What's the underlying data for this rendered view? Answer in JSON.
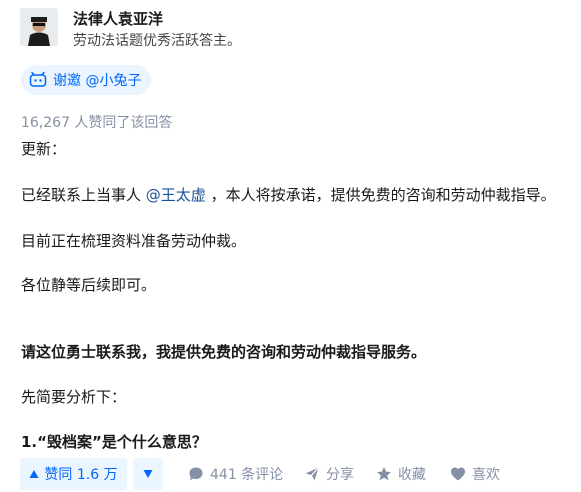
{
  "author": {
    "name": "法律人袁亚洋",
    "bio": "劳动法话题优秀活跃答主。"
  },
  "invite": {
    "label": "谢邀 @小兔子"
  },
  "vote_summary": "16,267 人赞同了该回答",
  "content": {
    "p1": "更新：",
    "p2_before": "已经联系上当事人 ",
    "p2_mention": "@王太虚",
    "p2_after": " ，本人将按承诺，提供免费的咨询和劳动仲裁指导。",
    "p3": "目前正在梳理资料准备劳动仲裁。",
    "p4": "各位静等后续即可。",
    "p5": "请这位勇士联系我，我提供免费的咨询和劳动仲裁指导服务。",
    "p6": "先简要分析下：",
    "p7": "1.“毁档案”是个什么意思？"
  },
  "actions": {
    "vote_up_label": "赞同 1.6 万",
    "comments_label": "441 条评论",
    "share_label": "分享",
    "favorite_label": "收藏",
    "like_label": "喜欢"
  },
  "colors": {
    "accent": "#0066ff",
    "muted": "#8590a6",
    "mention": "#175199"
  }
}
